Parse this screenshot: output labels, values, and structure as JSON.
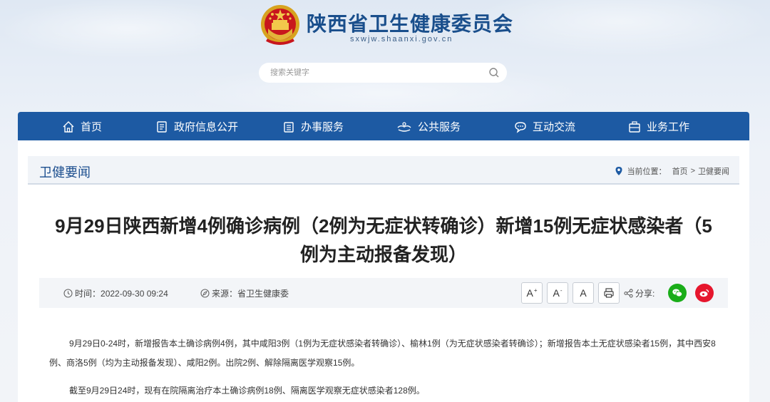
{
  "header": {
    "site_title": "陕西省卫生健康委员会",
    "site_domain": "sxwjw.shaanxi.gov.cn",
    "search_placeholder": "搜索关键字"
  },
  "nav": {
    "items": [
      {
        "label": "首页",
        "icon": "home-icon"
      },
      {
        "label": "政府信息公开",
        "icon": "document-list-icon"
      },
      {
        "label": "办事服务",
        "icon": "clipboard-icon"
      },
      {
        "label": "公共服务",
        "icon": "hands-icon"
      },
      {
        "label": "互动交流",
        "icon": "chat-icon"
      },
      {
        "label": "业务工作",
        "icon": "briefcase-icon"
      }
    ]
  },
  "section": {
    "title": "卫健要闻",
    "location_label": "当前位置：",
    "crumb_home": "首页",
    "crumb_sep": ">",
    "crumb_current": "卫健要闻"
  },
  "article": {
    "title": "9月29日陕西新增4例确诊病例（2例为无症状转确诊）新增15例无症状感染者（5例为主动报备发现）",
    "time_label": "时间：",
    "time_value": "2022-09-30 09:24",
    "source_label": "来源：",
    "source_value": "省卫生健康委",
    "font_increase": "A",
    "font_increase_sup": "+",
    "font_decrease": "A",
    "font_decrease_sup": "-",
    "font_reset": "A",
    "share_label": "分享:",
    "paragraphs": [
      "9月29日0-24时，新增报告本土确诊病例4例，其中咸阳3例（1例为无症状感染者转确诊）、榆林1例（为无症状感染者转确诊）；新增报告本土无症状感染者15例，其中西安8例、商洛5例（均为主动报备发现）、咸阳2例。出院2例、解除隔离医学观察15例。",
      "截至9月29日24时，现有在院隔离治疗本土确诊病例18例、隔离医学观察无症状感染者128例。"
    ]
  },
  "colors": {
    "nav_bg": "#1d5aa3",
    "title_blue": "#1a4f8c",
    "wechat_green": "#1aad19",
    "weibo_red": "#e6162d"
  }
}
